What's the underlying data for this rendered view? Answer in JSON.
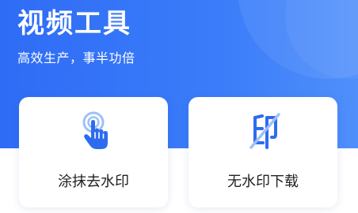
{
  "header": {
    "title": "视频工具",
    "subtitle": "高效生产，事半功倍"
  },
  "colors": {
    "brand_blue": "#2f6cf6",
    "icon_blue": "#2d6cf0",
    "icon_light_blue": "#9ec0fb",
    "text_dark": "#222222"
  },
  "tools": [
    {
      "label": "涂抹去水印",
      "icon": "touch-tap-icon"
    },
    {
      "label": "无水印下载",
      "icon": "no-watermark-icon"
    }
  ]
}
